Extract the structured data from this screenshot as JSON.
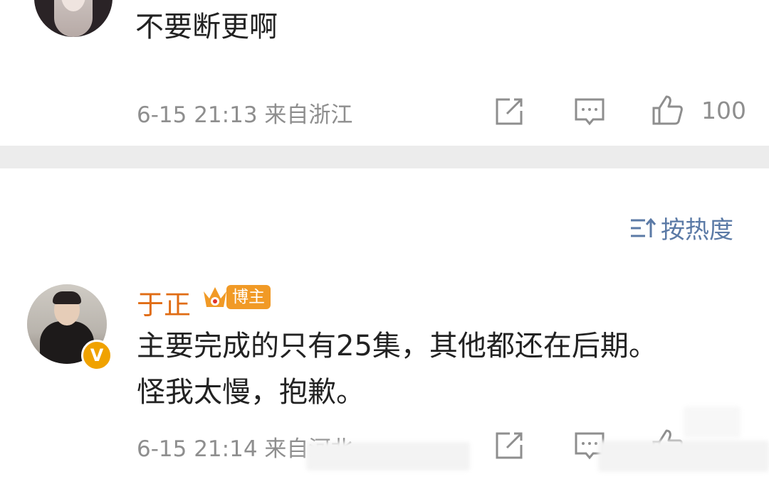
{
  "top_comment": {
    "text": "不要断更啊",
    "meta": "6-15 21:13 来自浙江",
    "like_count": "100",
    "icons": [
      "share-icon",
      "comment-icon",
      "like-icon"
    ]
  },
  "sort": {
    "label": "按热度",
    "icon": "sort-icon"
  },
  "main_comment": {
    "username": "于正",
    "badge": "博主",
    "line1": "主要完成的只有25集，其他都还在后期。",
    "line2": "怪我太慢，抱歉。",
    "meta": "6-15 21:14 来自河北",
    "verified_mark": "V",
    "icons": [
      "share-icon",
      "comment-icon",
      "like-icon"
    ]
  },
  "colors": {
    "username": "#e06c14",
    "badge": "#f19a26",
    "meta": "#8e8e8e",
    "sort": "#5b7aa6",
    "divider": "#ececec"
  }
}
